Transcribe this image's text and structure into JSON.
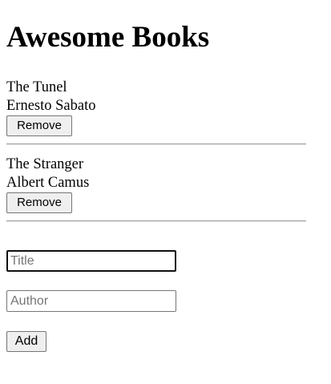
{
  "header": {
    "title": "Awesome Books"
  },
  "books": [
    {
      "title": "The Tunel",
      "author": "Ernesto Sabato",
      "remove_label": "Remove"
    },
    {
      "title": "The Stranger",
      "author": "Albert Camus",
      "remove_label": "Remove"
    }
  ],
  "form": {
    "title_field": {
      "value": "",
      "placeholder": "Title"
    },
    "author_field": {
      "value": "",
      "placeholder": "Author"
    },
    "add_label": "Add"
  }
}
